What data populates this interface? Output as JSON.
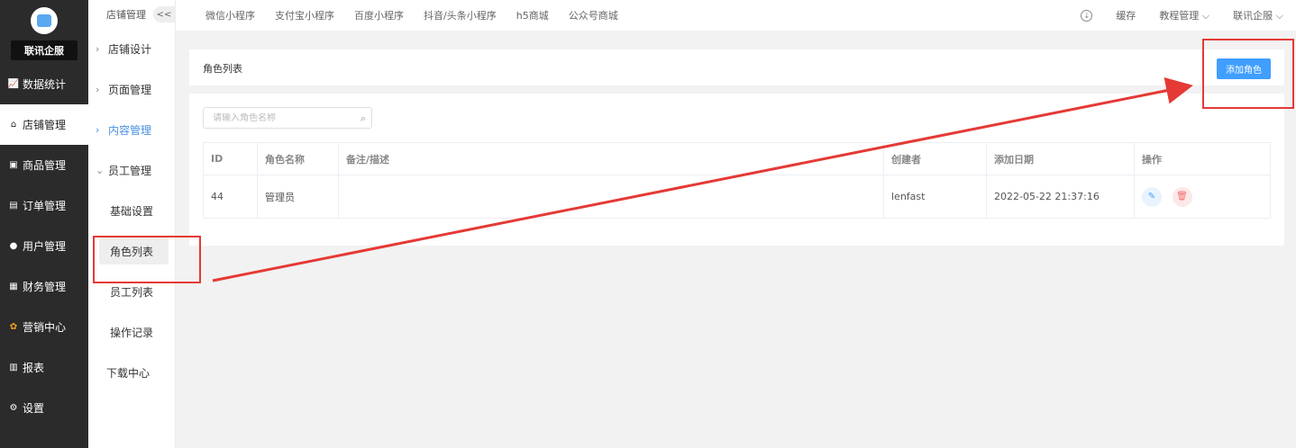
{
  "sidebar": {
    "brand": "联讯企服",
    "items": [
      {
        "label": "数据统计",
        "icon": "chart-icon"
      },
      {
        "label": "店铺管理",
        "icon": "store-icon",
        "active": true
      },
      {
        "label": "商品管理",
        "icon": "goods-icon"
      },
      {
        "label": "订单管理",
        "icon": "order-icon"
      },
      {
        "label": "用户管理",
        "icon": "user-icon"
      },
      {
        "label": "财务管理",
        "icon": "finance-icon"
      },
      {
        "label": "营销中心",
        "icon": "marketing-icon"
      },
      {
        "label": "报表",
        "icon": "report-icon"
      },
      {
        "label": "设置",
        "icon": "settings-icon"
      }
    ]
  },
  "subnav": {
    "header": "店铺管理",
    "collapse": "<<",
    "groups": [
      {
        "label": "店铺设计"
      },
      {
        "label": "页面管理"
      },
      {
        "label": "内容管理"
      },
      {
        "label": "员工管理"
      }
    ],
    "children": [
      {
        "label": "基础设置"
      },
      {
        "label": "角色列表"
      },
      {
        "label": "员工列表"
      },
      {
        "label": "操作记录"
      }
    ],
    "download": "下载中心"
  },
  "topbar": {
    "tabs": [
      "微信小程序",
      "支付宝小程序",
      "百度小程序",
      "抖音/头条小程序",
      "h5商城",
      "公众号商城"
    ],
    "cache": "缓存",
    "tutorial": "教程管理 ⌵",
    "account": "联讯企服 ⌵"
  },
  "page": {
    "title": "角色列表",
    "add_button": "添加角色",
    "search_placeholder": "请输入角色名称"
  },
  "table": {
    "headers": [
      "ID",
      "角色名称",
      "备注/描述",
      "创建者",
      "添加日期",
      "操作"
    ],
    "rows": [
      [
        "44",
        "管理员",
        "",
        "lenfast",
        "2022-05-22 21:37:16"
      ]
    ]
  },
  "colors": {
    "primary": "#409eff",
    "sidebar_bg": "#2b2b2b",
    "annotation": "#e53935"
  }
}
